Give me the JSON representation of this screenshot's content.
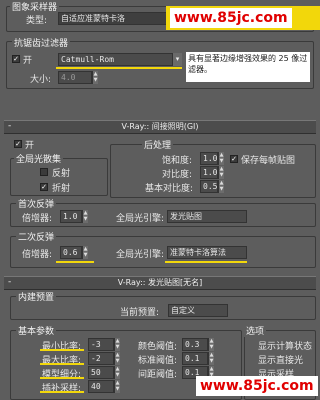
{
  "watermark_top": "www.85jc.com",
  "watermark_bottom": "www.85jc.com",
  "image_sampler": {
    "group_title": "图象采样器",
    "type_label": "类型:",
    "type_value": "自适应准蒙特卡洛"
  },
  "aa_filter": {
    "group_title": "抗锯齿过滤器",
    "on_label": "开",
    "filter_value": "Catmull-Rom",
    "size_label": "大小:",
    "size_value": "4.0",
    "description": "具有显著边缘增强效果的 25 像过滤器。"
  },
  "gi_rollout": {
    "title": "V-Ray:: 间接照明(GI)",
    "minus": "-"
  },
  "gi": {
    "on_label": "开",
    "caustics_title": "全局光散集",
    "reflective_label": "反射",
    "refractive_label": "折射",
    "post_title": "后处理",
    "saturation_label": "饱和度:",
    "saturation_value": "1.0",
    "contrast_label": "对比度:",
    "contrast_value": "1.0",
    "contrast_base_label": "基本对比度:",
    "contrast_base_value": "0.5",
    "save_map_label": "保存每帧贴图"
  },
  "primary": {
    "title": "首次反弹",
    "mult_label": "倍增器:",
    "mult_value": "1.0",
    "engine_label": "全局光引擎:",
    "engine_value": "发光贴图"
  },
  "secondary": {
    "title": "二次反弹",
    "mult_label": "倍增器:",
    "mult_value": "0.6",
    "engine_label": "全局光引擎:",
    "engine_value": "准蒙特卡洛算法"
  },
  "irr_rollout": {
    "title": "V-Ray:: 发光贴图[无名]",
    "minus": "-"
  },
  "preset": {
    "group_title": "内建预置",
    "current_label": "当前预置:",
    "current_value": "自定义"
  },
  "basic": {
    "group_title": "基本参数",
    "min_rate_label": "最小比率:",
    "min_rate_value": "-3",
    "max_rate_label": "最大比率:",
    "max_rate_value": "-2",
    "hsph_label": "模型细分:",
    "hsph_value": "50",
    "interp_label": "插补采样:",
    "interp_value": "40",
    "clr_label": "颜色阈值:",
    "clr_value": "0.3",
    "nrm_label": "标准阈值:",
    "nrm_value": "0.1",
    "dist_label": "间距阈值:",
    "dist_value": "0.1"
  },
  "options": {
    "group_title": "选项",
    "show_calc_label": "显示计算状态",
    "show_direct_label": "显示直接光",
    "show_samples_label": "显示采样"
  }
}
